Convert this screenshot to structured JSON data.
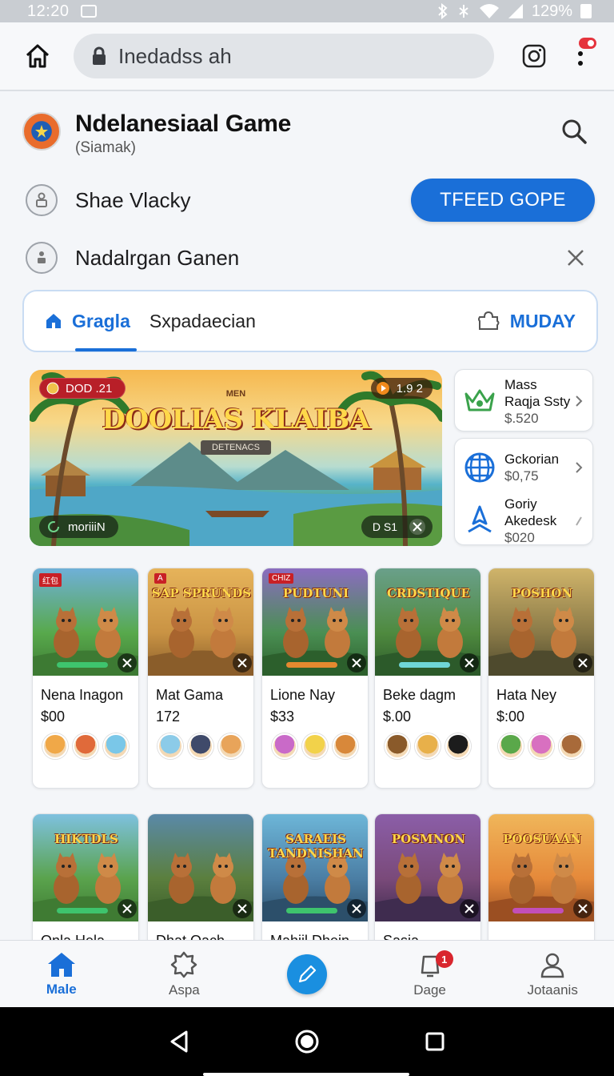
{
  "status_bar": {
    "time": "12:20",
    "battery": "129%"
  },
  "browser": {
    "url": "Inedadss ah",
    "menu_badge_color": "#e5343d"
  },
  "header": {
    "title": "Ndelanesiaal Game",
    "subtitle": "(Siamak)"
  },
  "rows": [
    {
      "label": "Shae Vlacky",
      "button": "TFEED GOPE"
    },
    {
      "label": "Nadalrgan Ganen"
    }
  ],
  "tabs": {
    "active": "Gragla",
    "second": "Sxpadaecian",
    "right": "MUDAY"
  },
  "banner": {
    "badge_left": "DOD .21",
    "badge_right": "1.9 2",
    "kicker": "MEN",
    "title": "DOOLIAS KLAIBA",
    "ribbon": "DETENACS",
    "pill_left": "moriiiN",
    "pill_right": "D S1"
  },
  "side_cards": [
    [
      {
        "name_line1": "Mass",
        "name_line2": "Raqja Ssty",
        "price": "$.520",
        "icon": "crown-icon"
      }
    ],
    [
      {
        "name_line1": "Gckorian",
        "price": "$0,75",
        "icon": "globe-icon"
      },
      {
        "name_line1": "Goriy Akedesk",
        "price": "$020",
        "icon": "rocket-icon"
      }
    ]
  ],
  "games_row1": [
    {
      "name": "Nena Inagon",
      "price": "$00",
      "tag": "红包",
      "art_title": "",
      "bar_color": "#3ec46d"
    },
    {
      "name": "Mat Gama",
      "price": "172",
      "tag": "A",
      "art_title": "SAP SPRUNDS",
      "bar_color": ""
    },
    {
      "name": "Lione Nay",
      "price": "$33",
      "tag": "CHIZ",
      "art_title": "PUDTUNI",
      "bar_color": "#e5892f"
    },
    {
      "name": "Beke dagm",
      "price": "$.00",
      "tag": "",
      "art_title": "CRDSTIQUE",
      "bar_color": "#6fd6d6"
    },
    {
      "name": "Hata Ney",
      "price": "$:00",
      "tag": "",
      "art_title": "POSHON",
      "bar_color": ""
    }
  ],
  "games_row2": [
    {
      "name": "Onla Hela",
      "art_title": "HIKTDLS",
      "bar_color": "#3ec46d"
    },
    {
      "name": "Dhat Oach",
      "art_title": "",
      "bar_color": ""
    },
    {
      "name": "Mahiil Dhein",
      "art_title": "SARAEIS TANDNISHAN",
      "bar_color": "#3ec46d"
    },
    {
      "name": "Sasia",
      "art_title": "POSMNON",
      "bar_color": ""
    },
    {
      "name": "",
      "art_title": "POOSUAAN",
      "bar_color": "#c24fb8"
    }
  ],
  "bottom_nav": {
    "items": [
      "Male",
      "Aspa",
      "",
      "Dage",
      "Jotaanis"
    ],
    "badge": "1"
  },
  "colors": {
    "accent": "#1a6fd8",
    "fab": "#1a8fe0"
  }
}
